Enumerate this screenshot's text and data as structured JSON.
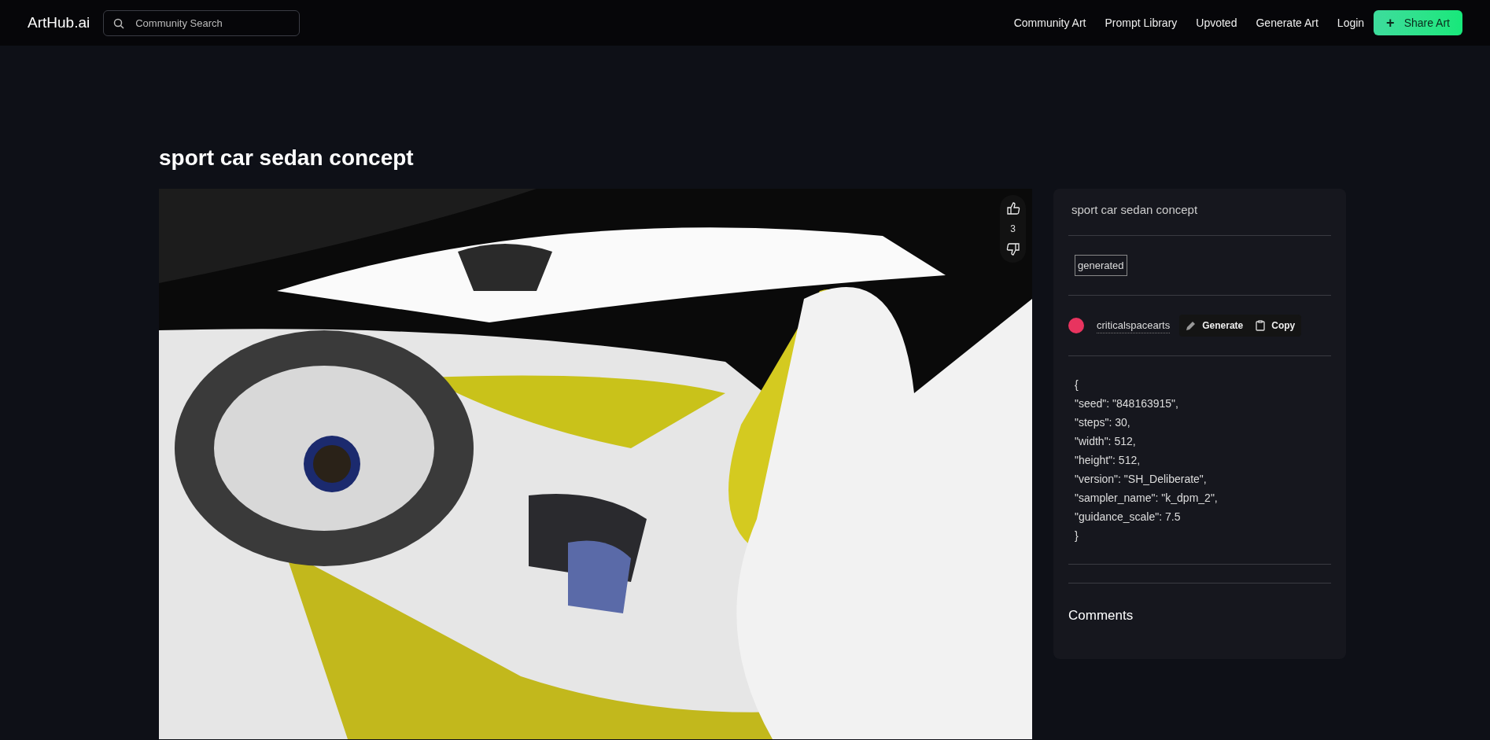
{
  "header": {
    "logo": "ArtHub.ai",
    "search": {
      "placeholder": "Community Search"
    },
    "nav": [
      "Community Art",
      "Prompt Library",
      "Upvoted",
      "Generate Art",
      "Login"
    ],
    "action_button": {
      "icon": "+",
      "label": "Share Art"
    }
  },
  "title": "sport car sedan concept",
  "votes": {
    "count": "3"
  },
  "panel": {
    "prompt": "sport car sedan concept",
    "tags": [
      "generated"
    ],
    "author": {
      "name": "criticalspacearts",
      "color": "#e8345f"
    },
    "actions": [
      {
        "kind": "generate",
        "label": "Generate"
      },
      {
        "kind": "copy",
        "label": "Copy"
      }
    ],
    "params": [
      "{",
      "\"seed\": \"848163915\",",
      "\"steps\": 30,",
      "\"width\": 512,",
      "\"height\": 512,",
      "\"version\": \"SH_Deliberate\",",
      "\"sampler_name\": \"k_dpm_2\",",
      "\"guidance_scale\": 7.5",
      "}"
    ],
    "comments_heading": "Comments"
  }
}
